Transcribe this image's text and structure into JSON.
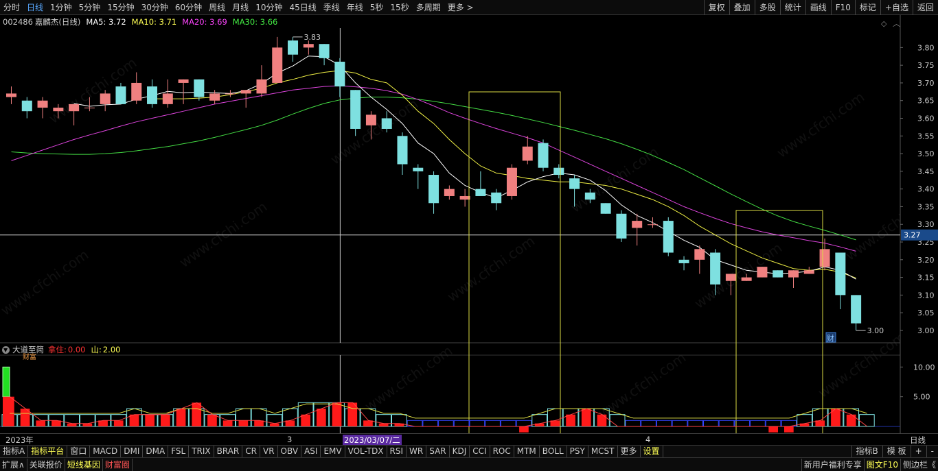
{
  "topbar": {
    "tabs": [
      "分时",
      "日线",
      "1分钟",
      "5分钟",
      "15分钟",
      "30分钟",
      "60分钟",
      "周线",
      "月线",
      "10分钟",
      "45日线",
      "季线",
      "年线",
      "5秒",
      "15秒",
      "多周期",
      "更多 >"
    ],
    "active_index": 1,
    "right_tools": [
      "复权",
      "叠加",
      "多股",
      "统计",
      "画线",
      "F10",
      "标记",
      "+自选",
      "返回"
    ]
  },
  "stock": {
    "code": "002486",
    "name": "嘉麟杰",
    "period": "(日线)"
  },
  "ma_legend": [
    {
      "label": "MA5: 3.72",
      "color": "#ffffff"
    },
    {
      "label": "MA10: 3.71",
      "color": "#ffff55"
    },
    {
      "label": "MA20: 3.69",
      "color": "#ff44ff"
    },
    {
      "label": "MA30: 3.66",
      "color": "#44ee44"
    }
  ],
  "price_axis": {
    "ticks": [
      "3.80",
      "3.75",
      "3.70",
      "3.65",
      "3.60",
      "3.55",
      "3.50",
      "3.45",
      "3.40",
      "3.35",
      "3.30",
      "3.25",
      "3.20",
      "3.15",
      "3.10",
      "3.05",
      "3.00"
    ],
    "cursor_price": "3.27"
  },
  "annotations": {
    "high_label": "3.83",
    "low_label": "3.00",
    "fin_marker": "财"
  },
  "indicator": {
    "name": "大道至简",
    "params": [
      {
        "label": "拿住:",
        "value": "0.00",
        "color": "#ff3333"
      },
      {
        "label": "山:",
        "value": "2.00",
        "color": "#ffff55"
      }
    ],
    "axis_ticks": [
      "10.00",
      "5.00"
    ],
    "side_label": "财富"
  },
  "x_axis": {
    "labels": [
      "2023年",
      "3",
      "2023/03/07/二",
      "4"
    ],
    "period_label": "日线"
  },
  "index_bar": {
    "items": [
      "指标A",
      "指标平台",
      "窗口",
      "MACD",
      "DMI",
      "DMA",
      "FSL",
      "TRIX",
      "BRAR",
      "CR",
      "VR",
      "OBV",
      "ASI",
      "EMV",
      "VOL-TDX",
      "RSI",
      "WR",
      "SAR",
      "KDJ",
      "CCI",
      "ROC",
      "MTM",
      "BOLL",
      "PSY",
      "MCST",
      "更多",
      "设置"
    ],
    "right_items": [
      "指标B",
      "模 板",
      "+",
      "-"
    ]
  },
  "bottom_bar": {
    "left_items": [
      {
        "label": "扩展∧",
        "color": "#ccc"
      },
      {
        "label": "关联报价",
        "color": "#ccc"
      },
      {
        "label": "短线基因",
        "color": "#ffff55"
      },
      {
        "label": "财富圈",
        "color": "#ff5555"
      }
    ],
    "right_items": [
      {
        "label": "新用户福利专享",
        "color": "#ccc"
      },
      {
        "label": "图文F10",
        "color": "#ffff55"
      },
      {
        "label": "侧边栏《",
        "color": "#ccc"
      }
    ]
  },
  "watermark": "www.cfchi.com",
  "chart_data": {
    "type": "candlestick",
    "ylim": [
      2.965,
      3.855
    ],
    "candles": [
      {
        "o": 3.66,
        "h": 3.69,
        "l": 3.64,
        "c": 3.67
      },
      {
        "o": 3.65,
        "h": 3.66,
        "l": 3.6,
        "c": 3.62
      },
      {
        "o": 3.63,
        "h": 3.66,
        "l": 3.6,
        "c": 3.65
      },
      {
        "o": 3.62,
        "h": 3.64,
        "l": 3.6,
        "c": 3.63
      },
      {
        "o": 3.62,
        "h": 3.64,
        "l": 3.58,
        "c": 3.64
      },
      {
        "o": 3.63,
        "h": 3.66,
        "l": 3.62,
        "c": 3.63
      },
      {
        "o": 3.64,
        "h": 3.68,
        "l": 3.62,
        "c": 3.67
      },
      {
        "o": 3.69,
        "h": 3.7,
        "l": 3.64,
        "c": 3.64
      },
      {
        "o": 3.65,
        "h": 3.73,
        "l": 3.64,
        "c": 3.7
      },
      {
        "o": 3.69,
        "h": 3.71,
        "l": 3.63,
        "c": 3.64
      },
      {
        "o": 3.64,
        "h": 3.71,
        "l": 3.63,
        "c": 3.67
      },
      {
        "o": 3.7,
        "h": 3.71,
        "l": 3.64,
        "c": 3.71
      },
      {
        "o": 3.71,
        "h": 3.71,
        "l": 3.65,
        "c": 3.66
      },
      {
        "o": 3.65,
        "h": 3.68,
        "l": 3.64,
        "c": 3.67
      },
      {
        "o": 3.67,
        "h": 3.68,
        "l": 3.66,
        "c": 3.67
      },
      {
        "o": 3.67,
        "h": 3.68,
        "l": 3.63,
        "c": 3.68
      },
      {
        "o": 3.67,
        "h": 3.75,
        "l": 3.66,
        "c": 3.71
      },
      {
        "o": 3.7,
        "h": 3.83,
        "l": 3.7,
        "c": 3.8
      },
      {
        "o": 3.82,
        "h": 3.83,
        "l": 3.76,
        "c": 3.78
      },
      {
        "o": 3.8,
        "h": 3.82,
        "l": 3.78,
        "c": 3.81
      },
      {
        "o": 3.81,
        "h": 3.81,
        "l": 3.75,
        "c": 3.77
      },
      {
        "o": 3.76,
        "h": 3.77,
        "l": 3.66,
        "c": 3.69
      },
      {
        "o": 3.68,
        "h": 3.68,
        "l": 3.55,
        "c": 3.57
      },
      {
        "o": 3.58,
        "h": 3.62,
        "l": 3.54,
        "c": 3.61
      },
      {
        "o": 3.6,
        "h": 3.62,
        "l": 3.56,
        "c": 3.57
      },
      {
        "o": 3.55,
        "h": 3.56,
        "l": 3.44,
        "c": 3.47
      },
      {
        "o": 3.46,
        "h": 3.47,
        "l": 3.4,
        "c": 3.45
      },
      {
        "o": 3.44,
        "h": 3.45,
        "l": 3.33,
        "c": 3.36
      },
      {
        "o": 3.38,
        "h": 3.41,
        "l": 3.37,
        "c": 3.4
      },
      {
        "o": 3.37,
        "h": 3.4,
        "l": 3.35,
        "c": 3.38
      },
      {
        "o": 3.4,
        "h": 3.45,
        "l": 3.39,
        "c": 3.38
      },
      {
        "o": 3.39,
        "h": 3.4,
        "l": 3.34,
        "c": 3.36
      },
      {
        "o": 3.38,
        "h": 3.47,
        "l": 3.37,
        "c": 3.46
      },
      {
        "o": 3.48,
        "h": 3.55,
        "l": 3.47,
        "c": 3.52
      },
      {
        "o": 3.53,
        "h": 3.54,
        "l": 3.45,
        "c": 3.46
      },
      {
        "o": 3.46,
        "h": 3.47,
        "l": 3.43,
        "c": 3.44
      },
      {
        "o": 3.43,
        "h": 3.44,
        "l": 3.35,
        "c": 3.4
      },
      {
        "o": 3.39,
        "h": 3.4,
        "l": 3.36,
        "c": 3.37
      },
      {
        "o": 3.36,
        "h": 3.36,
        "l": 3.33,
        "c": 3.33
      },
      {
        "o": 3.33,
        "h": 3.34,
        "l": 3.25,
        "c": 3.26
      },
      {
        "o": 3.29,
        "h": 3.33,
        "l": 3.24,
        "c": 3.31
      },
      {
        "o": 3.3,
        "h": 3.32,
        "l": 3.29,
        "c": 3.3
      },
      {
        "o": 3.31,
        "h": 3.32,
        "l": 3.21,
        "c": 3.22
      },
      {
        "o": 3.2,
        "h": 3.21,
        "l": 3.17,
        "c": 3.19
      },
      {
        "o": 3.2,
        "h": 3.24,
        "l": 3.16,
        "c": 3.23
      },
      {
        "o": 3.22,
        "h": 3.23,
        "l": 3.1,
        "c": 3.13
      },
      {
        "o": 3.14,
        "h": 3.16,
        "l": 3.1,
        "c": 3.16
      },
      {
        "o": 3.14,
        "h": 3.16,
        "l": 3.14,
        "c": 3.15
      },
      {
        "o": 3.15,
        "h": 3.18,
        "l": 3.15,
        "c": 3.18
      },
      {
        "o": 3.17,
        "h": 3.17,
        "l": 3.15,
        "c": 3.15
      },
      {
        "o": 3.15,
        "h": 3.17,
        "l": 3.12,
        "c": 3.17
      },
      {
        "o": 3.16,
        "h": 3.18,
        "l": 3.16,
        "c": 3.17
      },
      {
        "o": 3.18,
        "h": 3.26,
        "l": 3.17,
        "c": 3.23
      },
      {
        "o": 3.22,
        "h": 3.22,
        "l": 3.06,
        "c": 3.1
      },
      {
        "o": 3.1,
        "h": 3.1,
        "l": 3.0,
        "c": 3.02
      }
    ],
    "ma5": [
      null,
      null,
      null,
      null,
      3.642,
      3.634,
      3.638,
      3.64,
      3.654,
      3.664,
      3.676,
      3.672,
      3.674,
      3.672,
      3.67,
      3.678,
      3.698,
      3.728,
      3.748,
      3.776,
      3.774,
      3.75,
      3.7,
      3.66,
      3.625,
      3.585,
      3.53,
      3.5,
      3.445,
      3.41,
      3.39,
      3.375,
      3.396,
      3.42,
      3.435,
      3.445,
      3.44,
      3.425,
      3.395,
      3.355,
      3.325,
      3.305,
      3.28,
      3.255,
      3.235,
      3.2,
      3.185,
      3.17,
      3.165,
      3.16,
      3.163,
      3.167,
      3.18,
      3.17,
      3.145
    ],
    "ma10": [
      null,
      null,
      null,
      null,
      null,
      null,
      null,
      null,
      null,
      3.655,
      3.655,
      3.655,
      3.657,
      3.66,
      3.667,
      3.675,
      3.685,
      3.7,
      3.71,
      3.722,
      3.73,
      3.735,
      3.728,
      3.71,
      3.7,
      3.665,
      3.62,
      3.585,
      3.54,
      3.5,
      3.465,
      3.445,
      3.438,
      3.43,
      3.425,
      3.42,
      3.42,
      3.415,
      3.41,
      3.4,
      3.385,
      3.37,
      3.35,
      3.325,
      3.295,
      3.27,
      3.245,
      3.225,
      3.205,
      3.19,
      3.175,
      3.17,
      3.173,
      3.165,
      3.148
    ],
    "ma20": [
      3.48,
      3.495,
      3.51,
      3.525,
      3.54,
      3.553,
      3.565,
      3.578,
      3.59,
      3.6,
      3.61,
      3.62,
      3.63,
      3.64,
      3.648,
      3.656,
      3.664,
      3.672,
      3.68,
      3.685,
      3.69,
      3.692,
      3.689,
      3.685,
      3.678,
      3.668,
      3.653,
      3.635,
      3.616,
      3.6,
      3.585,
      3.571,
      3.558,
      3.545,
      3.53,
      3.51,
      3.49,
      3.47,
      3.45,
      3.43,
      3.41,
      3.39,
      3.37,
      3.35,
      3.333,
      3.317,
      3.302,
      3.29,
      3.279,
      3.27,
      3.262,
      3.254,
      3.247,
      3.236,
      3.224
    ],
    "ma30": [
      3.505,
      3.502,
      3.5,
      3.499,
      3.498,
      3.498,
      3.5,
      3.503,
      3.508,
      3.514,
      3.52,
      3.528,
      3.536,
      3.546,
      3.557,
      3.568,
      3.58,
      3.595,
      3.612,
      3.628,
      3.642,
      3.652,
      3.657,
      3.66,
      3.66,
      3.658,
      3.654,
      3.648,
      3.641,
      3.633,
      3.625,
      3.617,
      3.608,
      3.598,
      3.588,
      3.577,
      3.566,
      3.554,
      3.542,
      3.528,
      3.512,
      3.495,
      3.475,
      3.455,
      3.432,
      3.409,
      3.386,
      3.364,
      3.343,
      3.324,
      3.308,
      3.295,
      3.283,
      3.27,
      3.256
    ],
    "indicator": {
      "ylim": [
        0,
        12
      ],
      "hills": [
        2,
        2,
        2,
        2,
        2,
        2,
        2,
        2,
        3,
        2,
        2,
        3,
        3,
        2,
        2,
        3,
        3,
        2,
        3,
        4,
        4,
        4,
        3,
        3,
        2,
        2,
        1,
        1,
        1,
        1,
        1,
        1,
        1,
        1,
        2,
        3,
        3,
        3,
        3,
        2,
        1,
        1,
        1,
        1,
        1,
        1,
        1,
        1,
        1,
        1,
        1,
        2,
        3,
        3,
        3,
        2
      ],
      "red": [
        5,
        3,
        1,
        1,
        0.5,
        0.5,
        1,
        1,
        2,
        2,
        2,
        3,
        4,
        2,
        1,
        1,
        1,
        0.5,
        1,
        2,
        3,
        4,
        4,
        1,
        0.5,
        0.5,
        0,
        0,
        0,
        0,
        0,
        0,
        0,
        -1,
        0.5,
        1,
        2,
        3,
        2,
        0,
        0,
        0,
        0,
        0,
        0,
        0,
        0,
        0,
        0,
        -1,
        -1,
        0.5,
        1,
        3,
        2,
        0
      ],
      "green_bar_height": 5
    }
  }
}
